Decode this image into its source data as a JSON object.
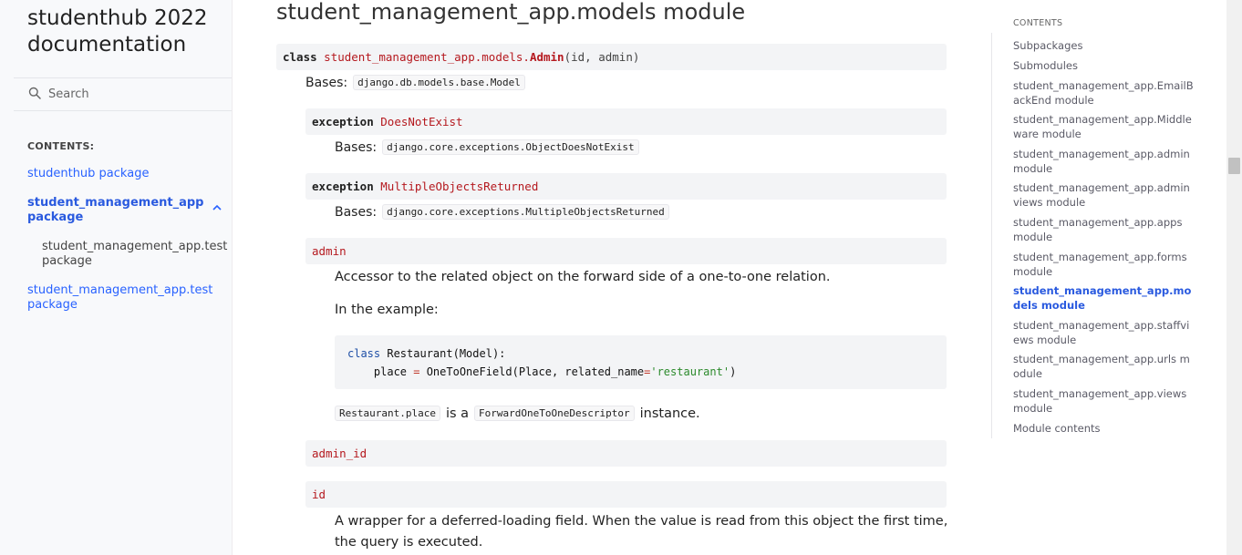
{
  "sidebar": {
    "brand_line1": "studenthub 2022",
    "brand_line2": "documentation",
    "search_placeholder": "Search",
    "contents_caption": "CONTENTS:",
    "links": {
      "studenthub_package": "studenthub package",
      "student_mgmt_app_pkg_1": "student_management_app",
      "student_mgmt_app_pkg_2": "package",
      "test_pkg_sub_1": "student_management_app.test",
      "test_pkg_sub_2": "package",
      "test_pkg_1": "student_management_app.test",
      "test_pkg_2": "package"
    }
  },
  "main": {
    "title": "student_management_app.models module",
    "class_sig": {
      "keyword": "class",
      "prefix": "student_management_app.models.",
      "name": "Admin",
      "params": "(id, admin)"
    },
    "bases_label": "Bases:",
    "class_bases": "django.db.models.base.Model",
    "does_not_exist": {
      "keyword": "exception",
      "name": "DoesNotExist",
      "bases": "django.core.exceptions.ObjectDoesNotExist"
    },
    "multiple_objects": {
      "keyword": "exception",
      "name": "MultipleObjectsReturned",
      "bases": "django.core.exceptions.MultipleObjectsReturned"
    },
    "admin_attr": {
      "name": "admin",
      "desc": "Accessor to the related object on the forward side of a one-to-one relation.",
      "example_intro": "In the example:",
      "code": {
        "kw_class": "class",
        "class_decl": " Restaurant(Model):",
        "line2_indent": "    place ",
        "eq": "=",
        "line2_call": " OneToOneField(Place, related_name",
        "eq2": "=",
        "str": "'restaurant'",
        "close": ")"
      },
      "inst_code1": "Restaurant.place",
      "inst_mid": "is a",
      "inst_code2": "ForwardOneToOneDescriptor",
      "inst_end": "instance."
    },
    "admin_id": {
      "name": "admin_id"
    },
    "id_attr": {
      "name": "id",
      "desc_line1": "A wrapper for a deferred-loading field. When the value is read from this object the first time,",
      "desc_line2": "the query is executed."
    }
  },
  "toc": {
    "caption": "CONTENTS",
    "items": [
      "Subpackages",
      "Submodules",
      "student_management_app.EmailBackEnd module",
      "student_management_app.Middleware module",
      "student_management_app.admin module",
      "student_management_app.adminviews module",
      "student_management_app.apps module",
      "student_management_app.forms module",
      "student_management_app.models module",
      "student_management_app.staffviews module",
      "student_management_app.urls module",
      "student_management_app.views module",
      "Module contents"
    ]
  },
  "icons": {
    "search": "search-icon",
    "chevron": "chevron-up-icon"
  },
  "colors": {
    "link": "#2962ff",
    "signature_name": "#b5191f",
    "code_bg": "#f3f4f6",
    "sidebar_bg": "#f8f9fb"
  }
}
